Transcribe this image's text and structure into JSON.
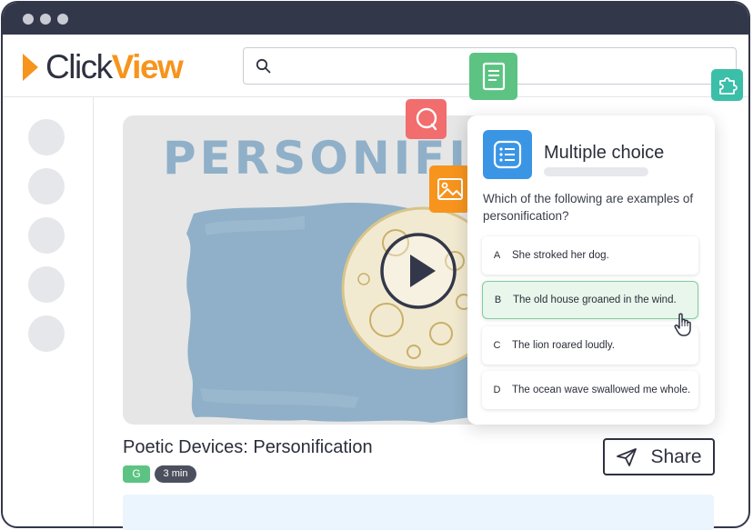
{
  "header": {
    "logo_click": "Click",
    "logo_view": "View",
    "search_placeholder": ""
  },
  "video": {
    "title_art_text": "PERSONIFIC",
    "title": "Poetic Devices: Personification",
    "rating": "G",
    "duration": "3 min",
    "share_label": "Share"
  },
  "question_card": {
    "type_label": "Multiple choice",
    "question": "Which of the following are examples of personification?",
    "options": [
      {
        "letter": "A",
        "text": "She stroked her dog.",
        "selected": false
      },
      {
        "letter": "B",
        "text": "The old house groaned in the wind.",
        "selected": true
      },
      {
        "letter": "C",
        "text": "The lion roared loudly.",
        "selected": false
      },
      {
        "letter": "D",
        "text": "The ocean wave swallowed me whole.",
        "selected": false
      }
    ]
  },
  "floating_icons": [
    {
      "name": "document-icon",
      "color": "#5cc383"
    },
    {
      "name": "puzzle-icon",
      "color": "#3bbfa9"
    },
    {
      "name": "comment-icon",
      "color": "#f26d6d"
    },
    {
      "name": "image-icon",
      "color": "#f7941d"
    }
  ],
  "colors": {
    "titlebar": "#33374a",
    "brand_orange": "#f7941d",
    "accent_blue": "#3a95e5",
    "selected_green": "#e8f6ec"
  }
}
